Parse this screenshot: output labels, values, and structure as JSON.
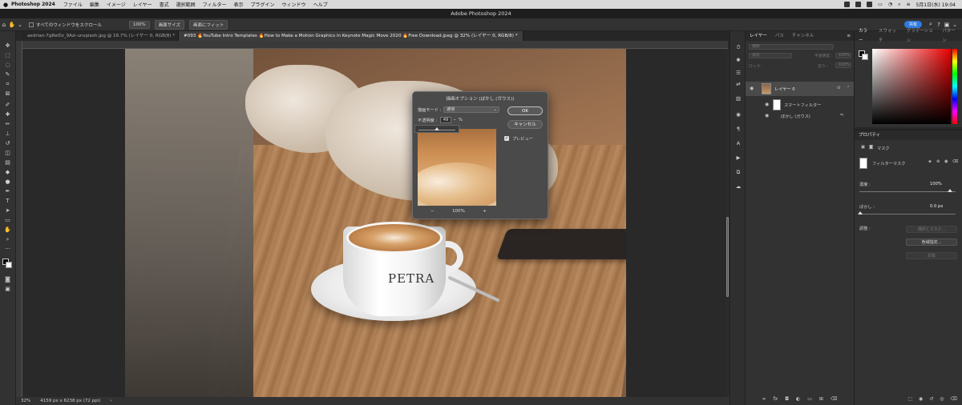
{
  "menubar": {
    "app_name": "Photoshop 2024",
    "items": [
      "ファイル",
      "編集",
      "イメージ",
      "レイヤー",
      "書式",
      "選択範囲",
      "フィルター",
      "表示",
      "プラグイン",
      "ウィンドウ",
      "ヘルプ"
    ],
    "clock": "5月1日(水) 19:04"
  },
  "window": {
    "title": "Adobe Photoshop 2024"
  },
  "options": {
    "scroll_all_label": "すべてのウィンドウをスクロール",
    "zoom_100": "100%",
    "fit_screen": "画面サイズ",
    "fill_screen": "画面にフィット",
    "share": "共有"
  },
  "tabs": [
    {
      "label": "aedrian-7g8wDz_9Azi-unsplash.jpg @ 16.7% (レイヤー 0, RGB/8) *"
    },
    {
      "label": "#093 🔥YouTube Intro Templates 🔥How to Make a Motion Graphics in Keynote Magic Move 2020 🔥Free Download.jpeg @ 32% (レイヤー 0, RGB/8) *"
    }
  ],
  "photo": {
    "cup_text": "PETRA"
  },
  "dialog": {
    "title": "描画オプション (ぼかし (ガウス))",
    "mode_label": "描画モード :",
    "mode_value": "通常",
    "opacity_label": "不透明度 :",
    "opacity_value": "49",
    "opacity_unit": "%",
    "ok": "OK",
    "cancel": "キャンセル",
    "preview_label": "プレビュー",
    "zoom_value": "100%",
    "zoom_out_icon": "−",
    "zoom_in_icon": "+"
  },
  "status": {
    "zoom": "32%",
    "doc_info": "4159 px x 6238 px (72 ppi)"
  },
  "layers_panel": {
    "tabs": [
      "レイヤー",
      "パス",
      "チャンネル"
    ],
    "search_kind": "種類",
    "blend_mode": "通常",
    "opacity_label": "不透明度 :",
    "opacity_value": "100%",
    "lock_label": "ロック :",
    "fill_label": "塗り :",
    "fill_value": "100%",
    "layer_name": "レイヤー 0",
    "smart_filter": "スマートフィルター",
    "filter_name": "ぼかし (ガウス)"
  },
  "color_panel": {
    "tabs": [
      "カラー",
      "スウォッチ",
      "グラデーション",
      "パターン"
    ]
  },
  "properties": {
    "title": "プロパティ",
    "mask_label": "マスク",
    "filter_mask": "フィルターマスク",
    "density_label": "濃度 :",
    "density_value": "100%",
    "feather_label": "ぼかし :",
    "feather_value": "0.0 px",
    "refine_label": "調整 :",
    "select_mask": "選択とマスク...",
    "color_range": "色域指定...",
    "invert": "反転"
  },
  "colors": {
    "accent": "#2f7be0",
    "fg": "#000000",
    "bg": "#ffffff"
  }
}
